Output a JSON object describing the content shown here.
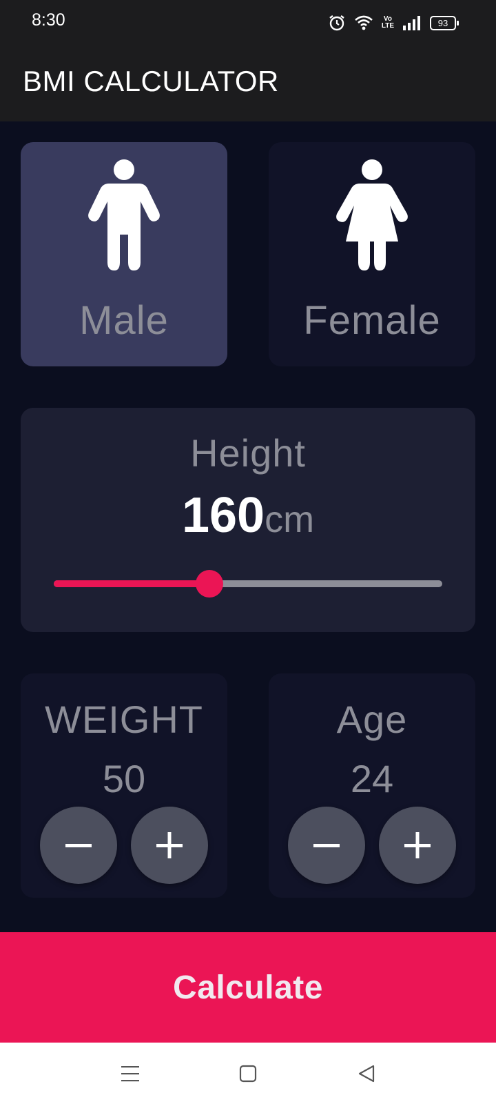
{
  "status_bar": {
    "time": "8:30",
    "battery": "93",
    "network": "Vo LTE"
  },
  "app_bar": {
    "title": "BMI CALCULATOR"
  },
  "gender": {
    "male_label": "Male",
    "female_label": "Female",
    "selected": "Male"
  },
  "height": {
    "label": "Height",
    "value": "160",
    "unit": "cm",
    "slider": {
      "min": 120,
      "max": 220,
      "value": 160,
      "fill_fraction": 0.4
    }
  },
  "weight": {
    "label": "WEIGHT",
    "value": "50"
  },
  "age": {
    "label": "Age",
    "value": "24"
  },
  "calculate": {
    "label": "Calculate"
  },
  "colors": {
    "accent": "#eb1555",
    "background": "#0b0e1f",
    "card_active": "#393b5e",
    "card_inactive": "#111328",
    "text_muted": "#8d8e98",
    "button_round": "#4c4f5e"
  },
  "nav_bar": {
    "icons": [
      "menu-icon",
      "home-square-icon",
      "back-triangle-icon"
    ]
  }
}
